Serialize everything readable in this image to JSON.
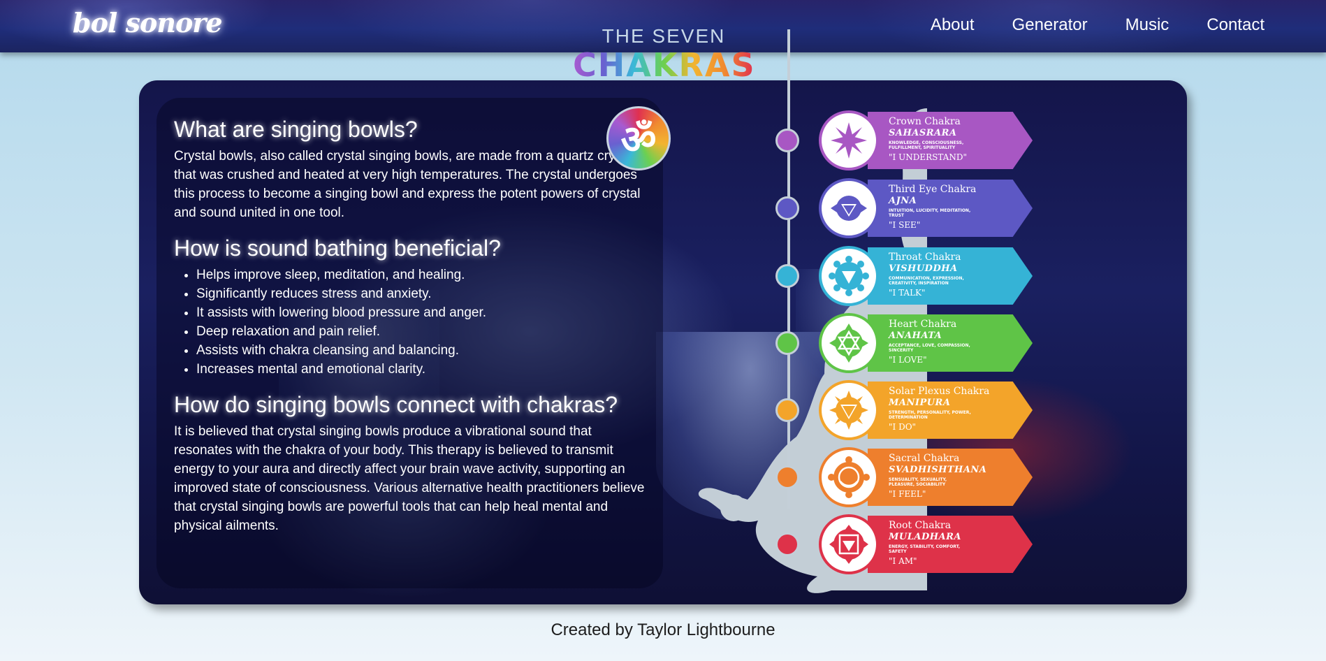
{
  "nav": {
    "brand": "bol sonore",
    "links": [
      "About",
      "Generator",
      "Music",
      "Contact"
    ]
  },
  "info": {
    "sections": [
      {
        "heading": "What are singing bowls?",
        "body": "Crystal bowls, also called crystal singing bowls, are made from a quartz crystal that was crushed and heated at very high temperatures. The crystal undergoes this process to become a singing bowl and express the potent powers of crystal and sound united in one tool."
      },
      {
        "heading": "How is sound bathing beneficial?",
        "items": [
          "Helps improve sleep, meditation, and healing.",
          "Significantly reduces stress and anxiety.",
          "It assists with lowering blood pressure and anger.",
          "Deep relaxation and pain relief.",
          "Assists with chakra cleansing and balancing.",
          "Increases mental and emotional clarity."
        ]
      },
      {
        "heading": "How do singing bowls connect with chakras?",
        "body": "It is believed that crystal singing bowls produce a vibrational sound that resonates with the chakra of your body. This therapy is believed to transmit energy to your aura and directly affect your brain wave activity, supporting an improved state of consciousness. Various alternative health practitioners believe that crystal singing bowls are powerful tools that can help heal mental and physical ailments."
      }
    ]
  },
  "chakras_graphic": {
    "title_top": "THE SEVEN",
    "title_main": "CHAKRAS",
    "om_symbol": "ॐ",
    "items": [
      {
        "name": "Crown Chakra",
        "sanskrit": "SAHASRARA",
        "traits": "KNOWLEDGE, CONSCIOUSNESS, FULFILLMENT, SPIRITUALITY",
        "mantra": "\"I UNDERSTAND\"",
        "color": "#a857c3",
        "icon": "lotus-icon"
      },
      {
        "name": "Third Eye Chakra",
        "sanskrit": "AJNA",
        "traits": "INTUITION, LUCIDITY, MEDITATION, TRUST",
        "mantra": "\"I SEE\"",
        "color": "#5d58c4",
        "icon": "third-eye-icon"
      },
      {
        "name": "Throat Chakra",
        "sanskrit": "VISHUDDHA",
        "traits": "COMMUNICATION, EXPRESSION, CREATIVITY, INSPIRATION",
        "mantra": "\"I TALK\"",
        "color": "#35b3d6",
        "icon": "throat-chakra-icon"
      },
      {
        "name": "Heart Chakra",
        "sanskrit": "ANAHATA",
        "traits": "ACCEPTANCE, LOVE, COMPASSION, SINCERITY",
        "mantra": "\"I LOVE\"",
        "color": "#5fc447",
        "icon": "heart-chakra-icon"
      },
      {
        "name": "Solar Plexus Chakra",
        "sanskrit": "MANIPURA",
        "traits": "STRENGTH, PERSONALITY, POWER, DETERMINATION",
        "mantra": "\"I DO\"",
        "color": "#f3a42a",
        "icon": "solar-plexus-icon"
      },
      {
        "name": "Sacral Chakra",
        "sanskrit": "SVADHISHTHANA",
        "traits": "SENSUALITY, SEXUALITY, PLEASURE, SOCIABILITY",
        "mantra": "\"I FEEL\"",
        "color": "#ee7f2d",
        "icon": "sacral-chakra-icon"
      },
      {
        "name": "Root Chakra",
        "sanskrit": "MULADHARA",
        "traits": "ENERGY, STABILITY, COMFORT, SAFETY",
        "mantra": "\"I AM\"",
        "color": "#de3249",
        "icon": "root-chakra-icon"
      }
    ]
  },
  "footer": {
    "credit": "Created by Taylor Lightbourne"
  }
}
